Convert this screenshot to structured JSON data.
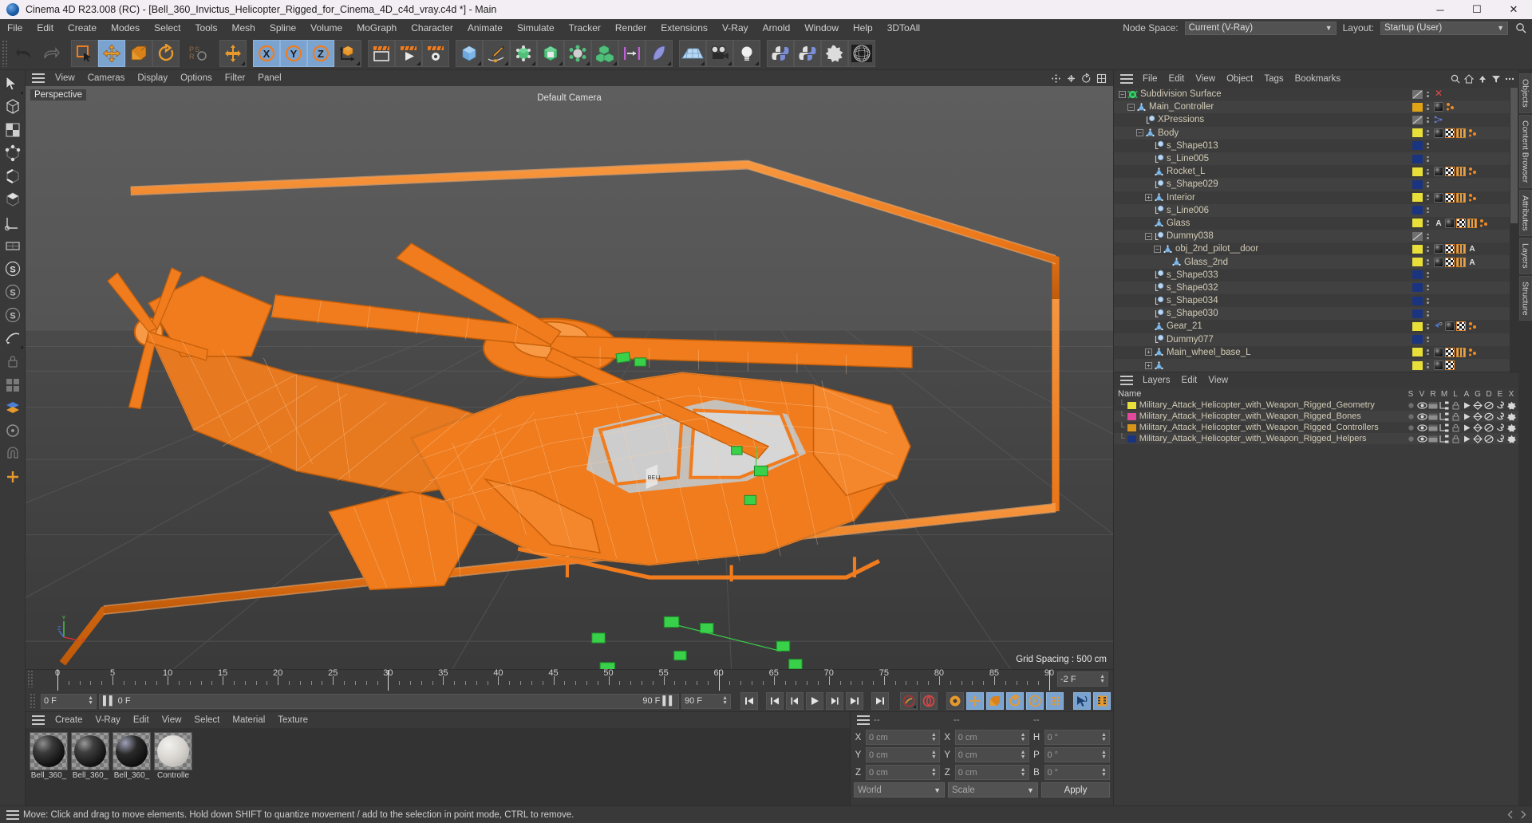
{
  "window": {
    "title": "Cinema 4D R23.008 (RC) - [Bell_360_Invictus_Helicopter_Rigged_for_Cinema_4D_c4d_vray.c4d *] - Main",
    "minimize": "─",
    "maximize": "☐",
    "close": "✕"
  },
  "menubar": {
    "items": [
      "File",
      "Edit",
      "Create",
      "Modes",
      "Select",
      "Tools",
      "Mesh",
      "Spline",
      "Volume",
      "MoGraph",
      "Character",
      "Animate",
      "Simulate",
      "Tracker",
      "Render",
      "Extensions",
      "V-Ray",
      "Arnold",
      "Window",
      "Help",
      "3DToAll"
    ],
    "node_space_label": "Node Space:",
    "node_space_value": "Current (V-Ray)",
    "layout_label": "Layout:",
    "layout_value": "Startup (User)",
    "search_icon": "search-icon"
  },
  "viewport": {
    "menu": [
      "View",
      "Cameras",
      "Display",
      "Options",
      "Filter",
      "Panel"
    ],
    "projection_label": "Perspective",
    "camera_label": "Default Camera",
    "grid_spacing": "Grid Spacing : 500 cm",
    "axis_x": "X",
    "axis_y": "Y",
    "axis_z": "Z"
  },
  "timeline": {
    "tick_labels": [
      "0",
      "5",
      "10",
      "15",
      "20",
      "25",
      "30",
      "35",
      "40",
      "45",
      "50",
      "55",
      "60",
      "65",
      "70",
      "75",
      "80",
      "85",
      "90"
    ],
    "current_frame": "0 F",
    "range_start": "0 F",
    "range_end": "90 F",
    "end_frame_field": "90 F",
    "preview_end": "-2 F",
    "transport": [
      "go-to-start",
      "prev-key",
      "prev-frame",
      "play",
      "next-frame",
      "next-key",
      "go-to-end"
    ],
    "record_buttons": [
      "autokey-icon",
      "record-icon",
      "keyframe-settings-icon",
      "position-key-icon",
      "scale-key-icon",
      "rotation-key-icon",
      "param-key-icon",
      "point-level-key-icon"
    ],
    "right_buttons": [
      "motion-system-icon",
      "timeline-icon"
    ]
  },
  "materials": {
    "menu": [
      "Create",
      "V-Ray",
      "Edit",
      "View",
      "Select",
      "Material",
      "Texture"
    ],
    "items": [
      {
        "name": "Bell_360_",
        "color": "#1d1d1d",
        "type": "glossy-black"
      },
      {
        "name": "Bell_360_",
        "color": "#222222",
        "type": "striped-black"
      },
      {
        "name": "Bell_360_",
        "color": "#141414",
        "type": "dark-black"
      },
      {
        "name": "Controlle",
        "color": "#d8d6d2",
        "type": "matte-white"
      }
    ]
  },
  "coordinates": {
    "headers": [
      "--",
      "--",
      "--"
    ],
    "rows": [
      {
        "left_axis": "X",
        "left_value": "0 cm",
        "mid_axis": "X",
        "mid_value": "0 cm",
        "right_axis": "H",
        "right_value": "0 °"
      },
      {
        "left_axis": "Y",
        "left_value": "0 cm",
        "mid_axis": "Y",
        "mid_value": "0 cm",
        "right_axis": "P",
        "right_value": "0 °"
      },
      {
        "left_axis": "Z",
        "left_value": "0 cm",
        "mid_axis": "Z",
        "mid_value": "0 cm",
        "right_axis": "B",
        "right_value": "0 °"
      }
    ],
    "space_value": "World",
    "mode_value": "Scale",
    "apply_label": "Apply"
  },
  "object_manager": {
    "menu": [
      "File",
      "Edit",
      "View",
      "Object",
      "Tags",
      "Bookmarks"
    ],
    "rows": [
      {
        "label": "Subdivision Surface",
        "indent": 0,
        "toggle": "minus",
        "icon": "subdivision-surface-icon",
        "swatch": "#8a8a8a",
        "swatch_style": "disabled",
        "tags": [
          "close-x"
        ],
        "selected": false
      },
      {
        "label": "Main_Controller",
        "indent": 1,
        "toggle": "minus",
        "icon": "null-object-icon",
        "swatch": "#e0a316",
        "tags": [
          "material-sphere",
          "dots-orange"
        ],
        "selected": true
      },
      {
        "label": "XPressions",
        "indent": 2,
        "toggle": "none",
        "icon": "spline-icon",
        "swatch": "#8a8a8a",
        "swatch_style": "disabled",
        "tags": [
          "xpresso-icon"
        ],
        "selected": false
      },
      {
        "label": "Body",
        "indent": 2,
        "toggle": "minus",
        "icon": "null-object-icon",
        "swatch": "#e8df3a",
        "tags": [
          "material-sphere",
          "checker",
          "uv",
          "dots-orange"
        ],
        "selected": true
      },
      {
        "label": "s_Shape013",
        "indent": 3,
        "toggle": "none",
        "icon": "spline-icon",
        "swatch": "#1b3480",
        "tags": [],
        "selected": false
      },
      {
        "label": "s_Line005",
        "indent": 3,
        "toggle": "none",
        "icon": "spline-icon",
        "swatch": "#1b3480",
        "tags": [],
        "selected": false
      },
      {
        "label": "Rocket_L",
        "indent": 3,
        "toggle": "none",
        "icon": "null-object-icon",
        "swatch": "#e8df3a",
        "tags": [
          "material-sphere",
          "checker",
          "uv",
          "dots-orange"
        ],
        "selected": false
      },
      {
        "label": "s_Shape029",
        "indent": 3,
        "toggle": "none",
        "icon": "spline-icon",
        "swatch": "#1b3480",
        "tags": [],
        "selected": false
      },
      {
        "label": "Interior",
        "indent": 3,
        "toggle": "plus",
        "icon": "null-object-icon",
        "swatch": "#e8df3a",
        "tags": [
          "material-sphere",
          "checker",
          "uv",
          "dots-orange"
        ],
        "selected": false
      },
      {
        "label": "s_Line006",
        "indent": 3,
        "toggle": "none",
        "icon": "spline-icon",
        "swatch": "#1b3480",
        "tags": [],
        "selected": false
      },
      {
        "label": "Glass",
        "indent": 3,
        "toggle": "none",
        "icon": "null-object-icon",
        "swatch": "#e8df3a",
        "tags": [
          "letter-A",
          "material-sphere",
          "checker",
          "uv",
          "dots-orange"
        ],
        "selected": false
      },
      {
        "label": "Dummy038",
        "indent": 3,
        "toggle": "minus",
        "icon": "spline-icon",
        "swatch": "#8a8a8a",
        "swatch_style": "disabled",
        "tags": [],
        "selected": false
      },
      {
        "label": "obj_2nd_pilot__door",
        "indent": 4,
        "toggle": "minus",
        "icon": "null-object-icon",
        "swatch": "#e8df3a",
        "tags": [
          "material-sphere",
          "checker",
          "uv",
          "letter-A"
        ],
        "selected": false
      },
      {
        "label": "Glass_2nd",
        "indent": 5,
        "toggle": "none",
        "icon": "null-object-icon",
        "swatch": "#e8df3a",
        "tags": [
          "material-sphere",
          "checker",
          "uv",
          "letter-A"
        ],
        "selected": false
      },
      {
        "label": "s_Shape033",
        "indent": 3,
        "toggle": "none",
        "icon": "spline-icon",
        "swatch": "#1b3480",
        "tags": [],
        "selected": false
      },
      {
        "label": "s_Shape032",
        "indent": 3,
        "toggle": "none",
        "icon": "spline-icon",
        "swatch": "#1b3480",
        "tags": [],
        "selected": false
      },
      {
        "label": "s_Shape034",
        "indent": 3,
        "toggle": "none",
        "icon": "spline-icon",
        "swatch": "#1b3480",
        "tags": [],
        "selected": false
      },
      {
        "label": "s_Shape030",
        "indent": 3,
        "toggle": "none",
        "icon": "spline-icon",
        "swatch": "#1b3480",
        "tags": [],
        "selected": false
      },
      {
        "label": "Gear_21",
        "indent": 3,
        "toggle": "none",
        "icon": "null-object-icon",
        "swatch": "#e8df3a",
        "tags": [
          "constraint",
          "material-sphere",
          "checker",
          "dots-orange"
        ],
        "selected": false
      },
      {
        "label": "Dummy077",
        "indent": 3,
        "toggle": "none",
        "icon": "spline-icon",
        "swatch": "#1b3480",
        "tags": [],
        "selected": false
      },
      {
        "label": "Main_wheel_base_L",
        "indent": 3,
        "toggle": "plus",
        "icon": "null-object-icon",
        "swatch": "#e8df3a",
        "tags": [
          "material-sphere",
          "checker",
          "uv",
          "dots-orange"
        ],
        "selected": false
      },
      {
        "label": "",
        "indent": 3,
        "toggle": "plus",
        "icon": "null-object-icon",
        "swatch": "#e8df3a",
        "tags": [
          "material-sphere",
          "checker"
        ],
        "selected": false
      }
    ]
  },
  "layer_manager": {
    "menu": [
      "Layers",
      "Edit",
      "View"
    ],
    "name_header": "Name",
    "flag_headers": [
      "S",
      "V",
      "R",
      "M",
      "L",
      "A",
      "G",
      "D",
      "E",
      "X"
    ],
    "rows": [
      {
        "color": "#e8df3a",
        "name": "Military_Attack_Helicopter_with_Weapon_Rigged_Geometry"
      },
      {
        "color": "#e0499c",
        "name": "Military_Attack_Helicopter_with_Weapon_Rigged_Bones"
      },
      {
        "color": "#d9951a",
        "name": "Military_Attack_Helicopter_with_Weapon_Rigged_Controllers"
      },
      {
        "color": "#1b3480",
        "name": "Military_Attack_Helicopter_with_Weapon_Rigged_Helpers"
      }
    ]
  },
  "right_tabs": [
    "Objects",
    "Content Browser",
    "Attributes",
    "Layers",
    "Structure"
  ],
  "statusbar": {
    "message": "Move: Click and drag to move elements. Hold down SHIFT to quantize movement / add to the selection in point mode, CTRL to remove."
  },
  "toolbar": {
    "buttons": [
      "undo-icon",
      "redo-icon",
      "select-live-icon",
      "move-icon",
      "scale-icon",
      "rotate-icon",
      "psr-icon",
      "world-axis-icon",
      "axis-x-icon",
      "axis-y-icon",
      "axis-z-icon",
      "coordinate-system-icon",
      "render-view-icon",
      "render-picture-icon",
      "render-settings-icon",
      "cube-primitive-icon",
      "pen-spline-icon",
      "generator-icon",
      "deformer-icon",
      "scene-nodes-icon",
      "mograph-icon",
      "motion-clip-icon",
      "deform-object-icon",
      "floor-icon",
      "camera-icon",
      "light-icon",
      "python-icon",
      "python-field-icon",
      "xref-icon",
      "globe-icon"
    ]
  },
  "left_toolbar": {
    "buttons": [
      "live-selection-icon",
      "model-mode-icon",
      "texture-mode-icon",
      "point-mode-icon",
      "edge-mode-icon",
      "polygon-mode-icon",
      "enable-axis-icon",
      "workplane-icon",
      "snap-icon",
      "quantize-icon",
      "workplane-lock-icon",
      "measure-icon",
      "locked-icon",
      "viewport-solo-icon",
      "layer-icon",
      "render-region-icon",
      "magnet-icon",
      "add-icon"
    ]
  },
  "colors": {
    "accent_orange": "#f07c1e",
    "selection_blue": "#7ba3d0",
    "panel_bg": "#393939",
    "list_bg": "#3b3b3b"
  }
}
